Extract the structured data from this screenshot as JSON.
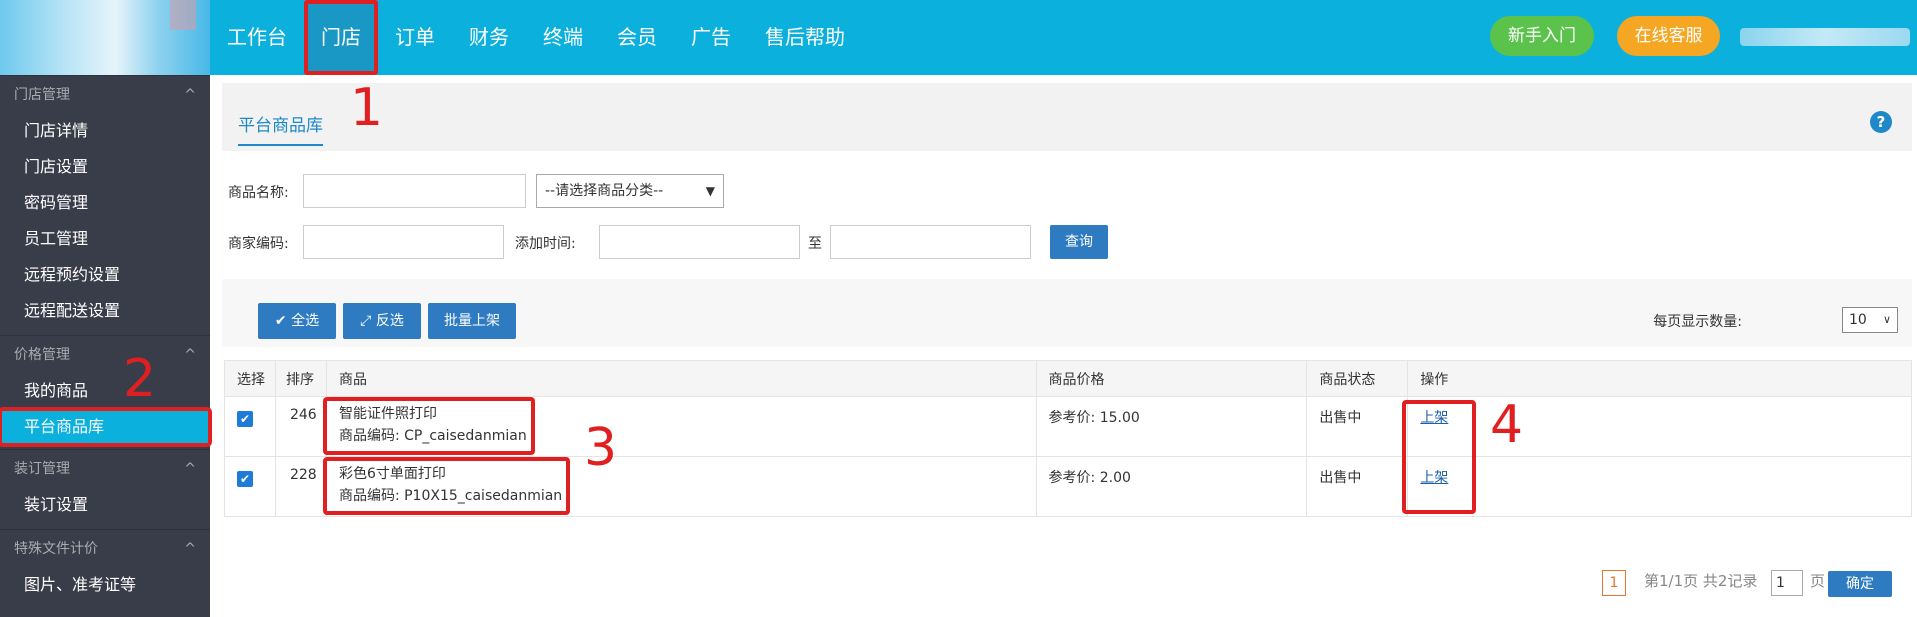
{
  "nav": {
    "items": [
      "工作台",
      "门店",
      "订单",
      "财务",
      "终端",
      "会员",
      "广告",
      "售后帮助"
    ],
    "guide_button": "新手入门",
    "service_button": "在线客服"
  },
  "sidebar": {
    "groups": [
      {
        "title": "门店管理",
        "items": [
          "门店详情",
          "门店设置",
          "密码管理",
          "员工管理",
          "远程预约设置",
          "远程配送设置"
        ]
      },
      {
        "title": "价格管理",
        "items": [
          "我的商品",
          "平台商品库"
        ]
      },
      {
        "title": "装订管理",
        "items": [
          "装订设置"
        ]
      },
      {
        "title": "特殊文件计价",
        "items": [
          "图片、准考证等"
        ]
      }
    ],
    "caret": "^"
  },
  "tab": {
    "label": "平台商品库",
    "help": "?"
  },
  "filters": {
    "name_label": "商品名称:",
    "category_placeholder": "--请选择商品分类--",
    "code_label": "商家编码:",
    "time_label": "添加时间:",
    "to_label": "至",
    "query_button": "查询"
  },
  "toolbar": {
    "select_all": "全选",
    "invert": "反选",
    "batch_shelve": "批量上架",
    "per_page_label": "每页显示数量:",
    "per_page_value": "10"
  },
  "table": {
    "headers": [
      "选择",
      "排序",
      "商品",
      "商品价格",
      "商品状态",
      "操作"
    ],
    "rows": [
      {
        "order": "246",
        "name": "智能证件照打印",
        "code": "商品编码:  CP_caisedanmian",
        "price": "参考价:  15.00",
        "status": "出售中",
        "action": "上架"
      },
      {
        "order": "228",
        "name": "彩色6寸单面打印",
        "code": "商品编码:  P10X15_caisedanmian",
        "price": "参考价:  2.00",
        "status": "出售中",
        "action": "上架"
      }
    ]
  },
  "annotations": [
    "1",
    "2",
    "3",
    "4"
  ],
  "pager": {
    "current": "1",
    "info": "第1/1页 共2记录",
    "input_value": "1",
    "unit": "页",
    "ok": "确定"
  },
  "colors": {
    "topbar": "#0bb1dc",
    "sidebar": "#393d49",
    "accent_blue": "#2e7bc2",
    "annotation_red": "#e02020"
  }
}
